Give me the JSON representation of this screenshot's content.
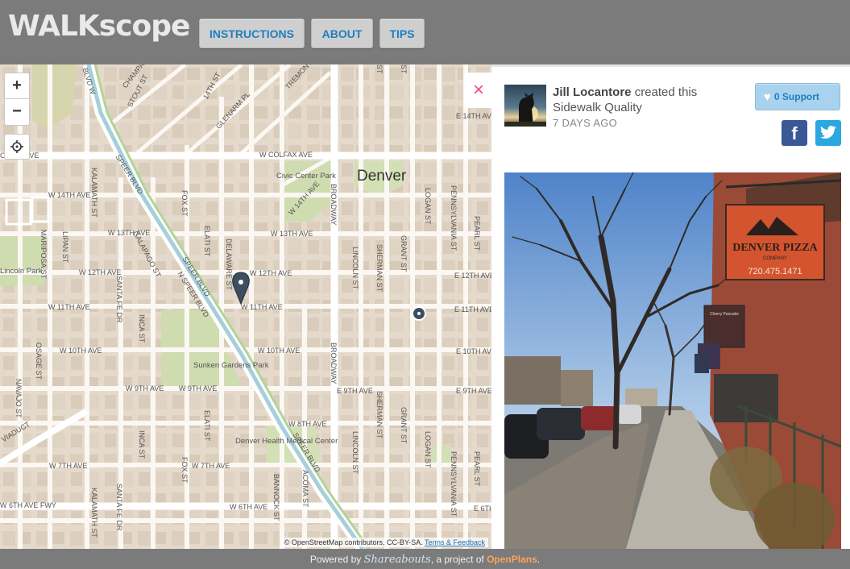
{
  "app": {
    "logo": "WALKscope"
  },
  "nav": {
    "instructions": "INSTRUCTIONS",
    "about": "ABOUT",
    "tips": "TIPS"
  },
  "map": {
    "controls": {
      "zoom_in": "+",
      "zoom_out": "−",
      "locate_icon": "crosshair-icon"
    },
    "labels": {
      "denver": "Denver",
      "civic_center": "Civic Center Park",
      "lincoln_park": "Lincoln Park",
      "sunken_gardens": "Sunken Gardens Park",
      "denver_health": "Denver Health Medical Center",
      "colfax_ave": "W COLFAX AVE",
      "colfax_ave_left": "OLFAX AVE",
      "e_14th": "E 14TH AVE",
      "w_14th": "W 14TH AVE",
      "w_14th_b": "W 14TH AVE",
      "w_13th": "W 13TH AVE",
      "w_13th_b": "W 13TH AVE",
      "w_12th": "W 12TH AVE",
      "w_12th_b": "W 12TH AVE",
      "e_12th": "E 12TH AVE",
      "w_11th": "W 11TH AVE",
      "w_11th_b": "W 11TH AVE",
      "e_11th": "E 11TH AVE",
      "w_10th": "W 10TH AVE",
      "w_10th_b": "W 10TH AVE",
      "e_10th": "E 10TH AVE",
      "w_9th": "W 9TH AVE",
      "w_9th_b": "W 9TH AVE",
      "e_9th": "E 9TH AVE",
      "e_9th_b": "E 9TH AVE",
      "w_8th": "W 8TH AVE",
      "w_7th": "W 7TH AVE",
      "w_7th_b": "W 7TH AVE",
      "w_6th": "W 6TH AVE",
      "w_6th_fwy": "W 6TH AVE FWY",
      "e_6th": "E 6TH",
      "viaduct": "VIADUCT",
      "speer_1": "SPEER BLVD",
      "speer_2": "SPEER BLVD",
      "n_speer": "N SPEER BLVD",
      "speer_3": "SPEER BLVD",
      "stout": "STOUT ST",
      "champa": "CHAMPA",
      "tremont": "TREMONT",
      "glenarm": "GLENARM PL",
      "w_14th_diag": "W 14TH AVE",
      "st_14th": "14TH ST",
      "blvd_w": "BLVD W",
      "kalamath": "KALAMATH ST",
      "kalamath_b": "KALAMATH ST",
      "lipan": "LIPAN ST",
      "mariposa": "MARIPOSA ST",
      "navajo": "NAVAJO ST",
      "osage": "OSAGE ST",
      "galapago": "GALAPAGO ST",
      "santa_fe": "SANTA FE DR",
      "santa_fe_b": "SANTA FE DR",
      "inca": "INCA ST",
      "inca_b": "INCA ST",
      "fox": "FOX ST",
      "fox_b": "FOX ST",
      "elati": "ELATI ST",
      "elati_b": "ELATI ST",
      "delaware": "DELAWARE ST",
      "bannock": "BANNOCK ST",
      "acoma": "ACOMA ST",
      "broadway": "BROADWAY",
      "broadway_b": "BROADWAY",
      "lincoln": "LINCOLN ST",
      "lincoln_b": "LINCOLN ST",
      "sherman": "SHERMAN ST",
      "sherman_b": "SHERMAN ST",
      "grant": "GRANT ST",
      "grant_b": "GRANT ST",
      "logan": "LOGAN ST",
      "logan_b": "LOGAN ST",
      "pennsylvania": "PENNSYLVANIA ST",
      "pennsylvania_b": "PENNSYLVANIA ST",
      "pearl": "PEARL ST",
      "pearl_b": "PEARL ST",
      "st_top": "ST",
      "st_top2": "ST"
    },
    "attribution": "© OpenStreetMap contributors, CC-BY-SA.",
    "attribution_link": "Terms & Feedback"
  },
  "panel": {
    "close": "×",
    "author": "Jill Locantore",
    "action": " created this Sidewalk Quality",
    "time": "7 DAYS AGO",
    "support": "0 Support",
    "facebook": "f",
    "icons": {
      "avatar": "avatar-icon",
      "support": "heart-icon",
      "facebook": "facebook-icon",
      "twitter": "twitter-icon"
    },
    "photo_sign": "DENVER PIZZA",
    "photo_sign_sub": "COMPANY",
    "photo_phone": "720.475.1471",
    "photo_small_sign": "Cherry Pancake"
  },
  "footer": {
    "powered_by": "Powered by ",
    "shareabouts": "Shareabouts",
    "project_of": ", a project of ",
    "openplans": "OpenPlans",
    "period": "."
  },
  "colors": {
    "header_bg": "#7b7b7b",
    "nav_text": "#1f7fbf",
    "close_x": "#ef5078",
    "support_bg": "#a9d2ee",
    "facebook": "#3a5796",
    "twitter": "#2ca7e0",
    "openplans": "#f9a55c"
  }
}
